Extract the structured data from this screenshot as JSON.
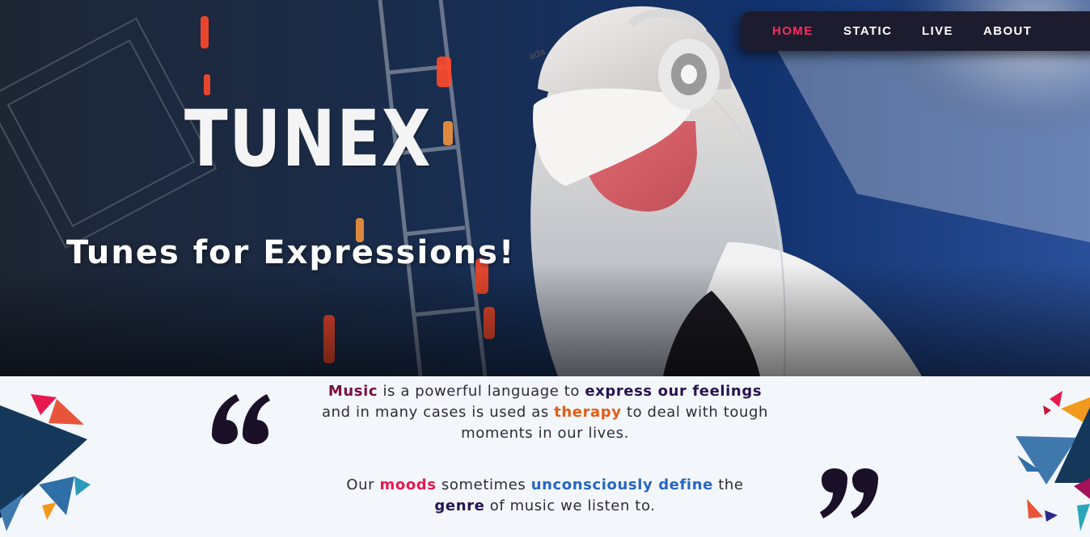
{
  "brand": {
    "logo_text": "TUNEX",
    "tagline": "Tunes for Expressions!"
  },
  "nav": {
    "items": [
      {
        "label": "HOME",
        "active": true
      },
      {
        "label": "STATIC",
        "active": false
      },
      {
        "label": "LIVE",
        "active": false
      },
      {
        "label": "ABOUT",
        "active": false
      }
    ],
    "active_color": "#ff2a5c"
  },
  "quote": {
    "open_mark": "“",
    "close_mark": "”",
    "paragraph1": {
      "w1": "Music",
      "t1": " is a powerful language to ",
      "w2": "express our feelings",
      "t2": " and in many cases is used as ",
      "w3": "therapy",
      "t3": " to deal with tough moments in our lives."
    },
    "paragraph2": {
      "t0": "Our ",
      "w1": "moods",
      "t1": " sometimes ",
      "w2": "unconsciously define",
      "t2": " the ",
      "w3": "genre",
      "t3": " of music we listen to."
    }
  },
  "colors": {
    "hero_bg": "#0d1630",
    "section_bg": "#f3f7fc",
    "navy": "#27144f",
    "music": "#7a1140",
    "orange": "#e55b13",
    "pink": "#e8194f",
    "blue": "#2566c2"
  }
}
